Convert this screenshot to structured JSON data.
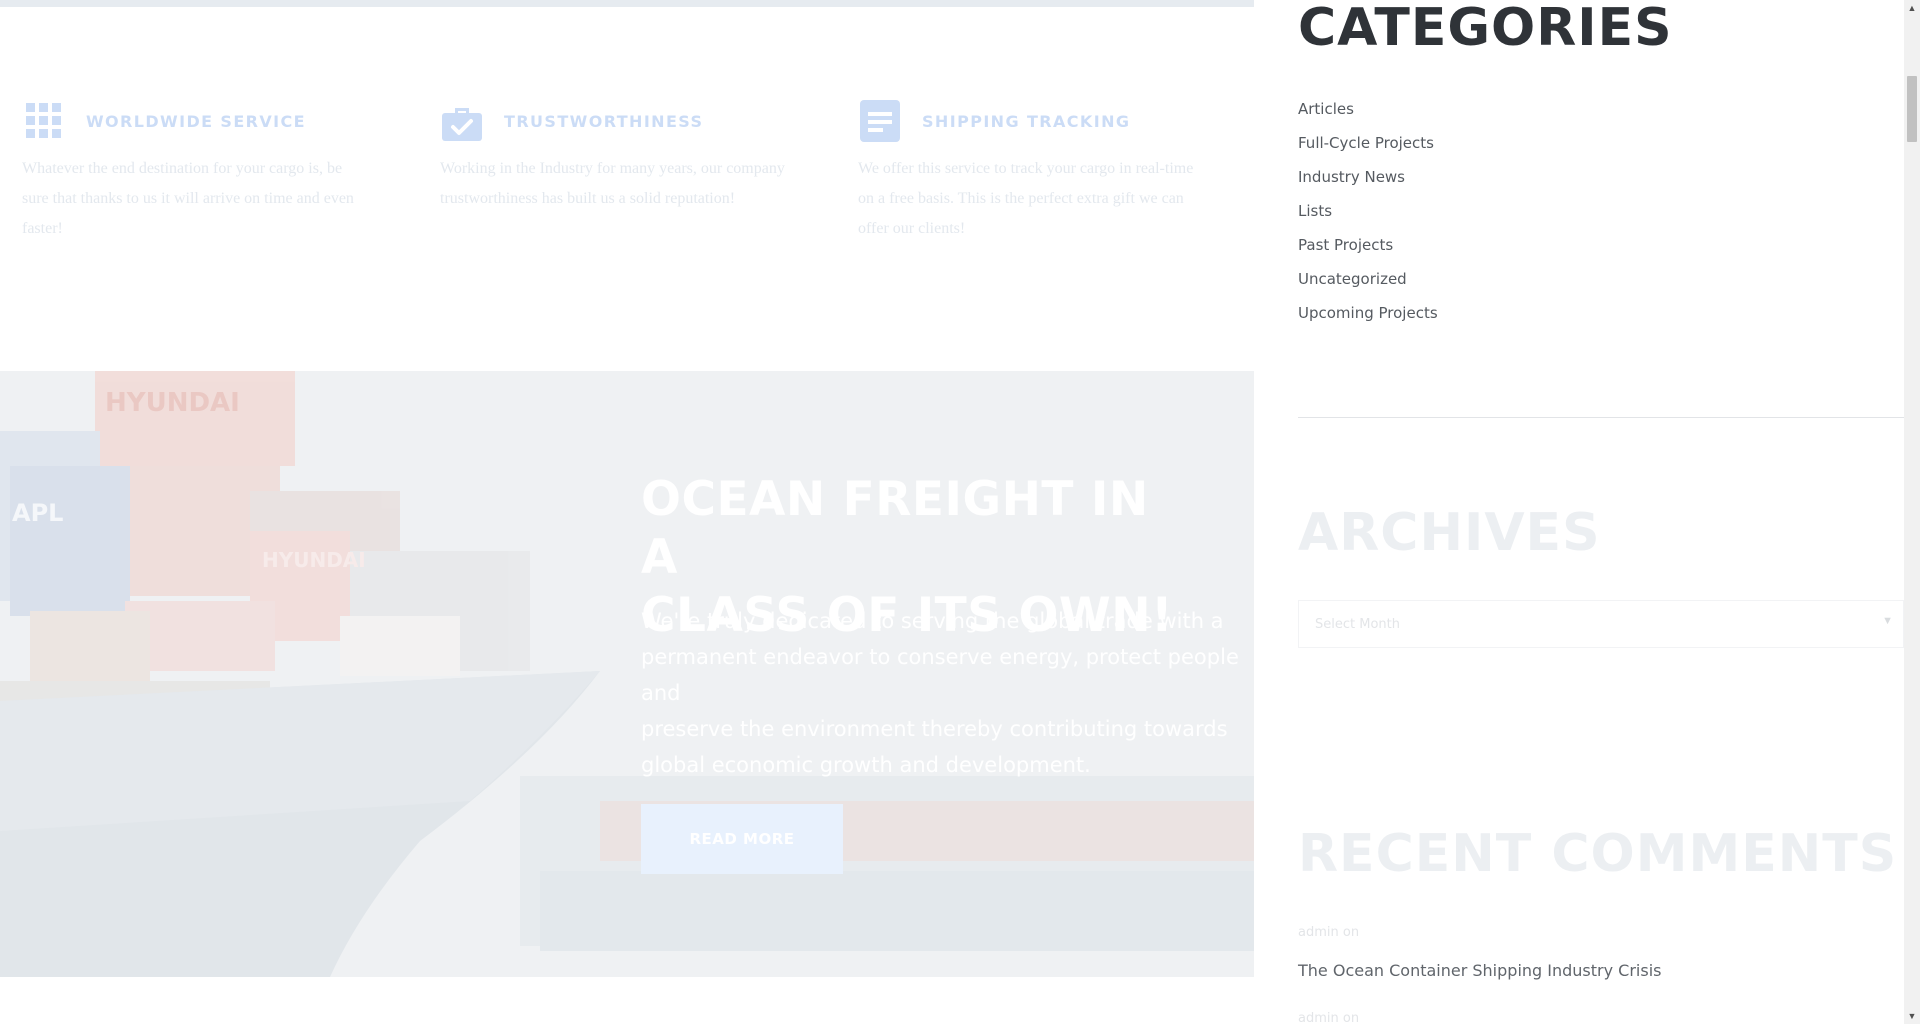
{
  "features": [
    {
      "icon": "grid-icon",
      "title": "WORLDWIDE SERVICE",
      "text_lines": [
        "Whatever the end destination for your cargo is, be",
        "sure that thanks to us it will arrive on time and even",
        "faster!"
      ]
    },
    {
      "icon": "briefcase-check-icon",
      "title": "TRUSTWORTHINESS",
      "text_lines": [
        "Working in the Industry for many years, our company",
        "trustworthiness has built us a solid reputation!"
      ]
    },
    {
      "icon": "document-icon",
      "title": "SHIPPING TRACKING",
      "text_lines": [
        "We offer this service to track your cargo in real-time",
        "on a free basis. This is the perfect extra gift we can",
        "offer our clients!"
      ]
    }
  ],
  "hero": {
    "title_lines": [
      "OCEAN FREIGHT IN A",
      "CLASS OF ITS OWN!"
    ],
    "text_lines": [
      "We're truly dedicated to serving the global trade with a",
      "permanent endeavor to conserve energy, protect people and",
      "preserve the environment thereby contributing towards",
      "global economic growth and development."
    ],
    "button_label": "READ MORE",
    "container_brands": [
      "HYUNDAI",
      "APL",
      "HYUNDAI"
    ]
  },
  "sidebar": {
    "categories_title": "CATEGORIES",
    "categories": [
      "Articles",
      "Full-Cycle Projects",
      "Industry News",
      "Lists",
      "Past Projects",
      "Uncategorized",
      "Upcoming Projects"
    ],
    "archives_title": "ARCHIVES",
    "archives_select": "Select Month",
    "recent_comments_title": "RECENT COMMENTS",
    "recent_comments": [
      {
        "author": "admin on",
        "post": "The Ocean Container Shipping Industry Crisis"
      },
      {
        "author": "admin on",
        "post": ""
      }
    ]
  },
  "colors": {
    "accent_faded": "#cbdcf6",
    "button_faded": "#e8f1fd",
    "heading_dark": "#2f3338"
  }
}
